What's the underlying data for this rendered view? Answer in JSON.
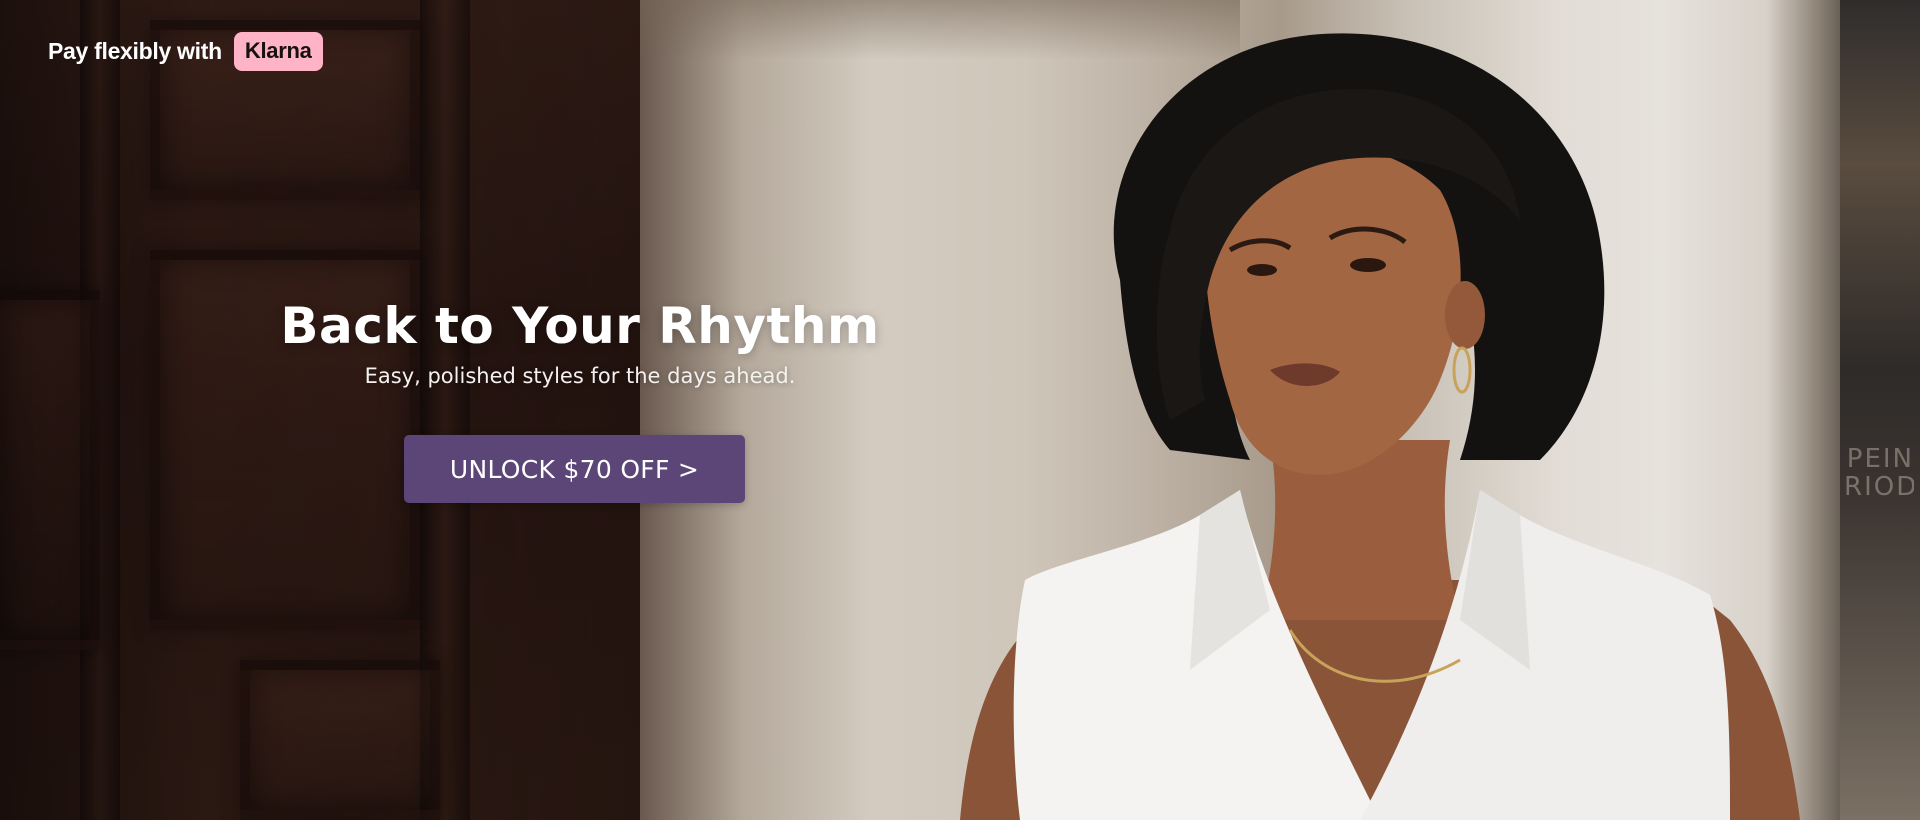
{
  "promo": {
    "prefix": "Pay flexibly with",
    "provider": "Klarna",
    "provider_color": "#ffb3c7"
  },
  "hero": {
    "title": "Back to Your Rhythm",
    "subtitle": "Easy, polished styles for the days ahead.",
    "cta_label": "UNLOCK $70 OFF >",
    "cta_color": "#5b4677"
  },
  "background": {
    "edge_text": "PEIN RIOD"
  }
}
